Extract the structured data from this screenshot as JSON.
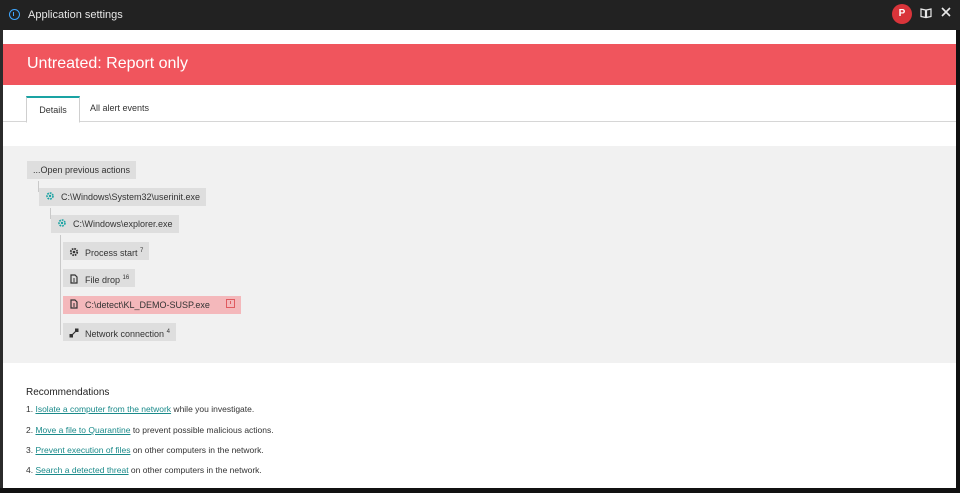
{
  "window": {
    "title": "Application settings",
    "user_initial": "P"
  },
  "banner": {
    "title": "Untreated: Report only",
    "color": "#f0555d"
  },
  "tabs": [
    {
      "label": "Details",
      "active": true
    },
    {
      "label": "All alert events",
      "active": false
    }
  ],
  "tree": {
    "open_previous": "...Open previous actions",
    "nodes": [
      {
        "label": "C:\\Windows\\System32\\userinit.exe",
        "icon": "gear-icon"
      },
      {
        "label": "C:\\Windows\\explorer.exe",
        "icon": "gear-icon"
      },
      {
        "label": "Process start",
        "count": "7",
        "icon": "cog-icon"
      },
      {
        "label": "File drop",
        "count": "16",
        "icon": "file-icon"
      },
      {
        "label": "C:\\detect\\KL_DEMO-SUSP.exe",
        "icon": "file-icon",
        "alert": true
      },
      {
        "label": "Network connection",
        "count": "4",
        "icon": "network-icon"
      }
    ]
  },
  "recommendations": {
    "heading": "Recommendations",
    "items": [
      {
        "num": "1.",
        "link": "Isolate a computer from the network",
        "rest": " while you investigate."
      },
      {
        "num": "2.",
        "link": "Move a file to Quarantine",
        "rest": " to prevent possible malicious actions."
      },
      {
        "num": "3.",
        "link": "Prevent execution of files",
        "rest": " on other computers in the network."
      },
      {
        "num": "4.",
        "link": "Search a detected threat",
        "rest": " on other computers in the network."
      }
    ]
  }
}
